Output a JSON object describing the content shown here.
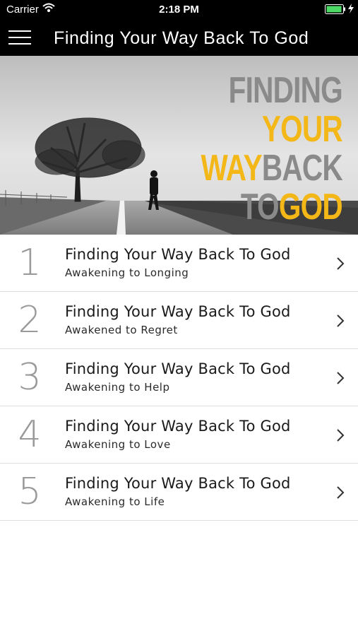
{
  "status_bar": {
    "carrier": "Carrier",
    "time": "2:18 PM"
  },
  "navbar": {
    "title": "Finding Your Way Back To God",
    "menu_icon": "hamburger-menu-icon"
  },
  "hero": {
    "line1": "FINDING",
    "line2": "YOUR",
    "line3_a": "WAY",
    "line3_b": "BACK",
    "line4_a": "TO",
    "line4_b": "GOD",
    "colors": {
      "grey": "#8a8a8a",
      "gold": "#f3b718"
    }
  },
  "sessions": [
    {
      "number": "1",
      "title": "Finding Your Way Back To God",
      "subtitle": "Awakening to Longing"
    },
    {
      "number": "2",
      "title": "Finding Your Way Back To God",
      "subtitle": "Awakened to Regret"
    },
    {
      "number": "3",
      "title": "Finding Your Way Back To God",
      "subtitle": "Awakening to Help"
    },
    {
      "number": "4",
      "title": "Finding Your Way Back To God",
      "subtitle": "Awakening to Love"
    },
    {
      "number": "5",
      "title": "Finding Your Way Back To God",
      "subtitle": "Awakening to Life"
    }
  ]
}
